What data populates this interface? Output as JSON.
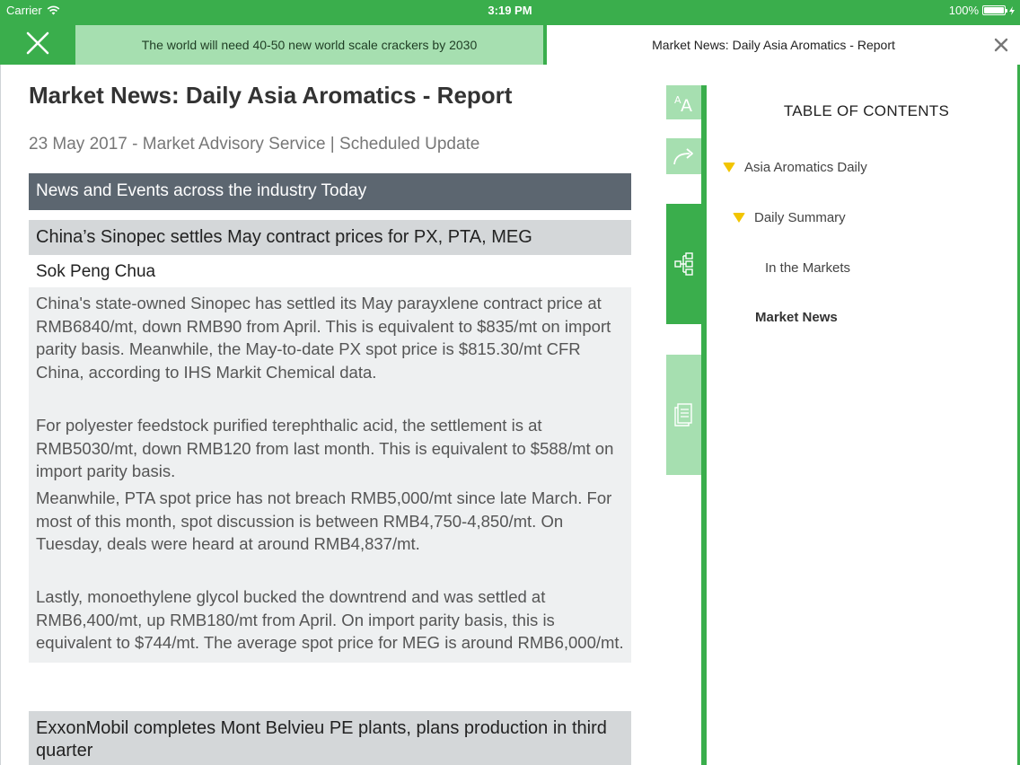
{
  "status_bar": {
    "carrier": "Carrier",
    "time": "3:19 PM",
    "battery": "100%",
    "battery_level": 1.0
  },
  "tabs": {
    "inactive_label": "The world will need 40-50 new world scale crackers by 2030",
    "active_label": "Market News: Daily Asia Aromatics - Report"
  },
  "article": {
    "title": "Market News: Daily Asia Aromatics - Report",
    "subtitle": "23 May 2017 - Market Advisory Service | Scheduled Update",
    "section_header": "News and Events across the industry Today",
    "stories": [
      {
        "title": "China’s Sinopec settles May contract prices for PX, PTA, MEG",
        "author": "Sok Peng Chua",
        "paragraphs": [
          "China's state-owned Sinopec has settled its May parayxlene contract price at RMB6840/mt, down RMB90 from April. This is equivalent to $835/mt on import parity basis. Meanwhile, the May-to-date PX spot price is $815.30/mt CFR China, according to IHS Markit Chemical data.",
          "For polyester feedstock purified terephthalic acid, the settlement is at RMB5030/mt, down RMB120 from last month. This is equivalent to $588/mt on import parity basis.",
          "Meanwhile, PTA spot price has not breach RMB5,000/mt since late March. For most of this month, spot discussion is between RMB4,750-4,850/mt. On Tuesday, deals were heard at around RMB4,837/mt.",
          "Lastly, monoethylene glycol bucked the downtrend and was settled at RMB6,400/mt, up RMB180/mt from April. On import parity basis, this is equivalent to $744/mt. The average spot price for MEG is around RMB6,000/mt."
        ]
      },
      {
        "title": "ExxonMobil completes Mont Belvieu PE plants, plans production in third quarter"
      }
    ]
  },
  "tools": {
    "font_size_icon": "font-size-icon",
    "share_icon": "share-icon",
    "toc_icon": "table-of-contents-icon",
    "notes_icon": "notes-icon"
  },
  "toc": {
    "heading": "TABLE OF CONTENTS",
    "items": [
      {
        "label": "Asia Aromatics Daily",
        "expanded": true
      },
      {
        "label": "Daily Summary",
        "expanded": true
      },
      {
        "label": "In the Markets"
      },
      {
        "label": "Market News",
        "current": true
      }
    ]
  },
  "colors": {
    "brand_green": "#3aae4c",
    "light_green": "#a6dfb0",
    "section_header": "#5c6670",
    "story_title_bg": "#d4d7d9",
    "story_body_bg": "#eef0f1",
    "toc_marker": "#f2c500"
  }
}
